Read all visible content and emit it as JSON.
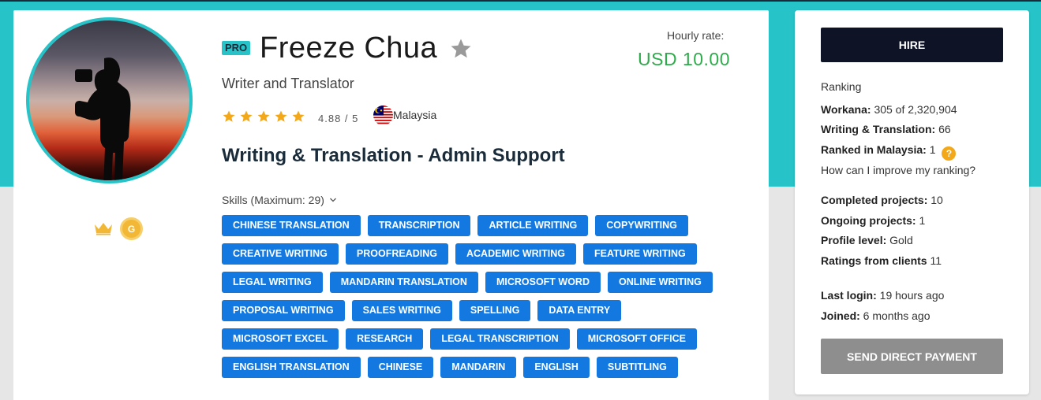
{
  "profile": {
    "pro_label": "PRO",
    "name": "Freeze Chua",
    "title": "Writer and Translator",
    "rating_stars": 5,
    "rating_text": "4.88 / 5",
    "country": "Malaysia",
    "headline": "Writing & Translation - Admin Support",
    "level_badge": "G"
  },
  "rate": {
    "label": "Hourly rate:",
    "value": "USD 10.00"
  },
  "skills": {
    "title": "Skills (Maximum: 29)",
    "items": [
      "CHINESE TRANSLATION",
      "TRANSCRIPTION",
      "ARTICLE WRITING",
      "COPYWRITING",
      "CREATIVE WRITING",
      "PROOFREADING",
      "ACADEMIC WRITING",
      "FEATURE WRITING",
      "LEGAL WRITING",
      "MANDARIN TRANSLATION",
      "MICROSOFT WORD",
      "ONLINE WRITING",
      "PROPOSAL WRITING",
      "SALES WRITING",
      "SPELLING",
      "DATA ENTRY",
      "MICROSOFT EXCEL",
      "RESEARCH",
      "LEGAL TRANSCRIPTION",
      "MICROSOFT OFFICE",
      "ENGLISH TRANSLATION",
      "CHINESE",
      "MANDARIN",
      "ENGLISH",
      "SUBTITLING"
    ]
  },
  "sidebar": {
    "hire_label": "HIRE",
    "ranking_title": "Ranking",
    "workana_label": "Workana:",
    "workana_value": "305 of 2,320,904",
    "category_label": "Writing & Translation:",
    "category_value": "66",
    "country_rank_label": "Ranked in Malaysia:",
    "country_rank_value": "1",
    "help_mark": "?",
    "improve_link": "How can I improve my ranking?",
    "completed_label": "Completed projects:",
    "completed_value": "10",
    "ongoing_label": "Ongoing projects:",
    "ongoing_value": "1",
    "level_label": "Profile level:",
    "level_value": "Gold",
    "ratings_label": "Ratings from clients",
    "ratings_value": "11",
    "last_login_label": "Last login:",
    "last_login_value": "19 hours ago",
    "joined_label": "Joined:",
    "joined_value": "6 months ago",
    "send_payment_label": "SEND DIRECT PAYMENT"
  },
  "colors": {
    "teal": "#26c4c8",
    "skill_blue": "#1379e0",
    "rate_green": "#2eab4a",
    "hire_dark": "#0e1326",
    "star_gold": "#f3a81a"
  }
}
